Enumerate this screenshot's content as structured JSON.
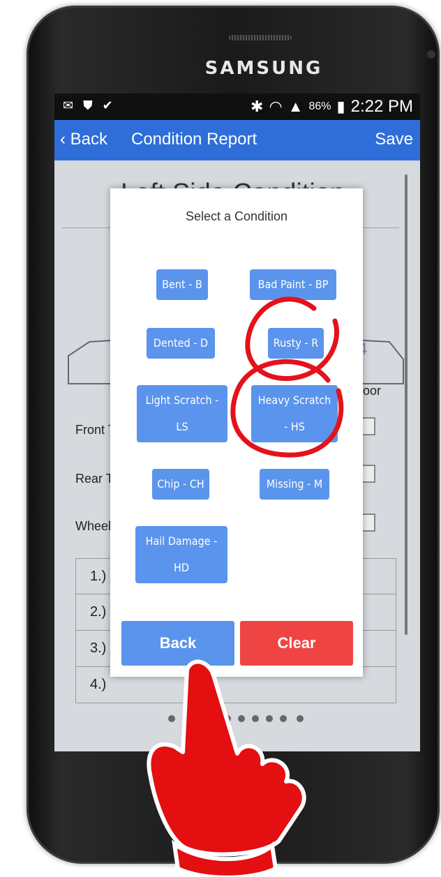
{
  "device": {
    "brand": "SAMSUNG"
  },
  "statusbar": {
    "battery": "86%",
    "time": "2:22 PM"
  },
  "navbar": {
    "back_label": "Back",
    "title": "Condition Report",
    "save_label": "Save"
  },
  "background_page": {
    "heading": "Left Side Condition",
    "col_poor": "Poor",
    "rows": [
      "Front Tire",
      "Rear Tire",
      "Wheels"
    ],
    "numbers": [
      "1",
      "2",
      "3",
      "4",
      "5",
      "6"
    ],
    "list": [
      "1.)",
      "2.)",
      "3.)",
      "4.)"
    ]
  },
  "modal": {
    "title": "Select a Condition",
    "options": [
      {
        "label": "Bent - B"
      },
      {
        "label": "Bad Paint - BP"
      },
      {
        "label": "Dented - D"
      },
      {
        "label": "Rusty - R"
      },
      {
        "label": "Light Scratch - LS"
      },
      {
        "label": "Heavy Scratch - HS"
      },
      {
        "label": "Chip - CH"
      },
      {
        "label": "Missing - M"
      },
      {
        "label": "Hail Damage - HD"
      }
    ],
    "back_label": "Back",
    "clear_label": "Clear"
  },
  "colors": {
    "navbar": "#2f6ed8",
    "option_button": "#5a94ec",
    "clear_button": "#ef4444",
    "annotation": "#e3121b"
  }
}
